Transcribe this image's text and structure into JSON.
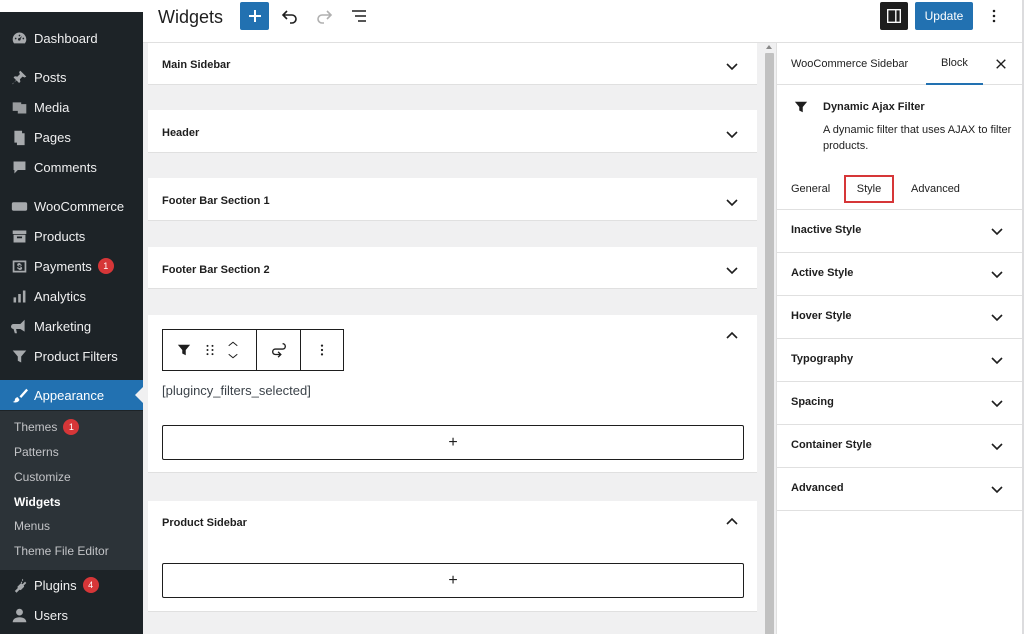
{
  "admin_menu": {
    "items": [
      {
        "label": "Dashboard",
        "icon": "dashboard-icon"
      },
      {
        "label": "Posts",
        "icon": "pin-icon"
      },
      {
        "label": "Media",
        "icon": "media-icon"
      },
      {
        "label": "Pages",
        "icon": "pages-icon"
      },
      {
        "label": "Comments",
        "icon": "comment-icon"
      },
      {
        "label": "WooCommerce",
        "icon": "woo-icon"
      },
      {
        "label": "Products",
        "icon": "archive-icon"
      },
      {
        "label": "Payments",
        "icon": "dollar-icon",
        "badge": "1"
      },
      {
        "label": "Analytics",
        "icon": "chart-bar-icon"
      },
      {
        "label": "Marketing",
        "icon": "megaphone-icon"
      },
      {
        "label": "Product Filters",
        "icon": "filter-icon"
      },
      {
        "label": "Appearance",
        "icon": "brush-icon"
      },
      {
        "label": "Plugins",
        "icon": "plugin-icon",
        "badge": "4"
      },
      {
        "label": "Users",
        "icon": "user-icon"
      }
    ],
    "submenu": [
      {
        "label": "Themes",
        "badge": "1"
      },
      {
        "label": "Patterns"
      },
      {
        "label": "Customize"
      },
      {
        "label": "Widgets"
      },
      {
        "label": "Menus"
      },
      {
        "label": "Theme File Editor"
      }
    ]
  },
  "header": {
    "title": "Widgets",
    "update_label": "Update"
  },
  "canvas": {
    "areas": [
      {
        "title": "Main Sidebar",
        "state": "collapsed"
      },
      {
        "title": "Header",
        "state": "collapsed"
      },
      {
        "title": "Footer Bar Section 1",
        "state": "collapsed"
      },
      {
        "title": "Footer Bar Section 2",
        "state": "collapsed"
      },
      {
        "title": "",
        "state": "expanded"
      },
      {
        "title": "Product Sidebar",
        "state": "expanded"
      }
    ],
    "shortcode": "[plugincy_filters_selected]",
    "appender_label": "+"
  },
  "settings": {
    "tabs": [
      "WooCommerce Sidebar",
      "Block"
    ],
    "active_tab": "Block",
    "block_title": "Dynamic Ajax Filter",
    "block_description": "A dynamic filter that uses AJAX to filter products.",
    "inner_tabs": [
      "General",
      "Style",
      "Advanced"
    ],
    "highlighted_inner_tab": "Style",
    "sections": [
      "Inactive Style",
      "Active Style",
      "Hover Style",
      "Typography",
      "Spacing",
      "Container Style",
      "Advanced"
    ]
  },
  "colors": {
    "admin_bg": "#1d2327",
    "accent": "#2271b1",
    "badge": "#d63638",
    "highlight_border": "#d63638"
  }
}
